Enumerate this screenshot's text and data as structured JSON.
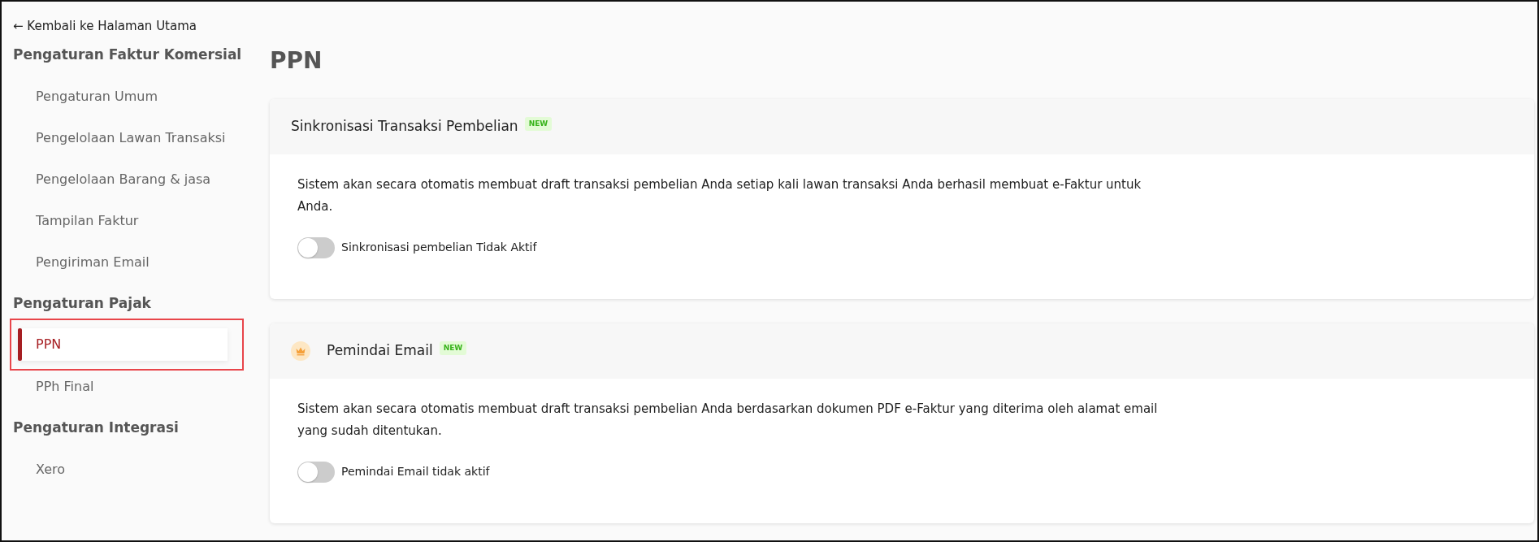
{
  "back_link": {
    "icon": "←",
    "label": "Kembali ke Halaman Utama"
  },
  "sidebar": {
    "groups": [
      {
        "heading": "Pengaturan Faktur Komersial",
        "items": [
          {
            "label": "Pengaturan Umum",
            "selected": false,
            "highlighted": false
          },
          {
            "label": "Pengelolaan Lawan Transaksi",
            "selected": false,
            "highlighted": false
          },
          {
            "label": "Pengelolaan Barang & jasa",
            "selected": false,
            "highlighted": false
          },
          {
            "label": "Tampilan Faktur",
            "selected": false,
            "highlighted": false
          },
          {
            "label": "Pengiriman Email",
            "selected": false,
            "highlighted": false
          }
        ]
      },
      {
        "heading": "Pengaturan Pajak",
        "items": [
          {
            "label": "PPN",
            "selected": true,
            "highlighted": true
          },
          {
            "label": "PPh Final",
            "selected": false,
            "highlighted": false
          }
        ]
      },
      {
        "heading": "Pengaturan Integrasi",
        "items": [
          {
            "label": "Xero",
            "selected": false,
            "highlighted": false
          }
        ]
      }
    ]
  },
  "page_title": "PPN",
  "cards": [
    {
      "title": "Sinkronisasi Transaksi Pembelian",
      "premium": false,
      "badge": "NEW",
      "description": "Sistem akan secara otomatis membuat draft transaksi pembelian Anda setiap kali lawan transaksi Anda berhasil membuat e-Faktur untuk Anda.",
      "toggle": {
        "on": false,
        "label": "Sinkronisasi pembelian Tidak Aktif"
      }
    },
    {
      "title": "Pemindai Email",
      "premium": true,
      "badge": "NEW",
      "description": "Sistem akan secara otomatis membuat draft transaksi pembelian Anda berdasarkan dokumen PDF e-Faktur yang diterima oleh alamat email yang sudah ditentukan.",
      "toggle": {
        "on": false,
        "label": "Pemindai Email tidak aktif"
      }
    }
  ]
}
